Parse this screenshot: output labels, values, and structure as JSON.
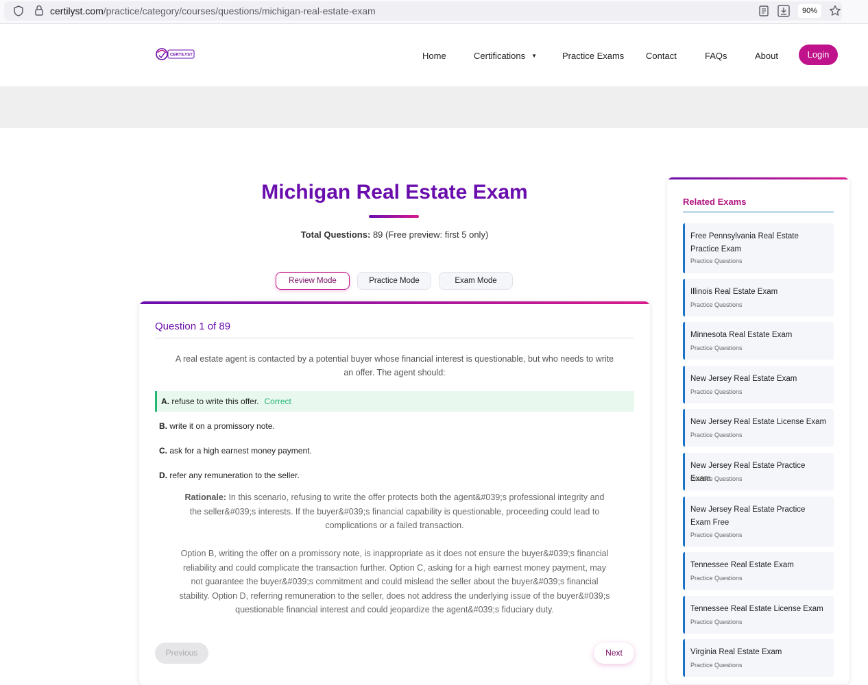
{
  "browser": {
    "url_domain": "certilyst.com",
    "url_path": "/practice/category/courses/questions/michigan-real-estate-exam",
    "zoom": "90%"
  },
  "header": {
    "logo_text": "CERTILYST",
    "nav": {
      "home": "Home",
      "certifications": "Certifications",
      "certifications_caret": "▼",
      "practice_exams": "Practice Exams",
      "contact": "Contact",
      "faqs": "FAQs",
      "about": "About"
    },
    "login": "Login"
  },
  "main": {
    "title": "Michigan Real Estate Exam",
    "total_label": "Total Questions:",
    "total_value": "89 (Free preview: first 5 only)",
    "modes": {
      "review": "Review Mode",
      "practice": "Practice Mode",
      "exam": "Exam Mode"
    }
  },
  "question": {
    "heading": "Question 1 of 89",
    "text": "A real estate agent is contacted by a potential buyer whose financial interest is questionable, but who needs to write an offer. The agent should:",
    "options": [
      {
        "letter": "A.",
        "text": "refuse to write this offer.",
        "tag": "Correct"
      },
      {
        "letter": "B.",
        "text": "write it on a promissory note."
      },
      {
        "letter": "C.",
        "text": "ask for a high earnest money payment."
      },
      {
        "letter": "D.",
        "text": "refer any remuneration to the seller."
      }
    ],
    "rationale_label": "Rationale:",
    "rationale_text": " In this scenario, refusing to write the offer protects both the agent&#039;s professional integrity and the seller&#039;s interests. If the buyer&#039;s financial capability is questionable, proceeding could lead to complications or a failed transaction.",
    "rationale_text2": "Option B, writing the offer on a promissory note, is inappropriate as it does not ensure the buyer&#039;s financial reliability and could complicate the transaction further. Option C, asking for a high earnest money payment, may not guarantee the buyer&#039;s commitment and could mislead the seller about the buyer&#039;s financial stability. Option D, referring remuneration to the seller, does not address the underlying issue of the buyer&#039;s questionable financial interest and could jeopardize the agent&#039;s fiduciary duty.",
    "prev": "Previous",
    "next": "Next"
  },
  "sidebar": {
    "title": "Related Exams",
    "items": [
      {
        "title": "Free Pennsylvania Real Estate Practice Exam",
        "sub": "Practice Questions"
      },
      {
        "title": "Illinois Real Estate Exam",
        "sub": "Practice Questions"
      },
      {
        "title": "Minnesota Real Estate Exam",
        "sub": "Practice Questions"
      },
      {
        "title": "New Jersey Real Estate Exam",
        "sub": "Practice Questions"
      },
      {
        "title": "New Jersey Real Estate License Exam",
        "sub": "Practice Questions"
      },
      {
        "title": "New Jersey Real Estate Practice Exam",
        "sub": "Practice Questions"
      },
      {
        "title": "New Jersey Real Estate Practice Exam Free",
        "sub": "Practice Questions"
      },
      {
        "title": "Tennessee Real Estate Exam",
        "sub": "Practice Questions"
      },
      {
        "title": "Tennessee Real Estate License Exam",
        "sub": "Practice Questions"
      },
      {
        "title": "Virginia Real Estate Exam",
        "sub": "Practice Questions"
      }
    ]
  },
  "colors": {
    "brand_purple": "#6a0dad",
    "brand_magenta": "#c0138b",
    "correct_green": "#22b573",
    "sidebar_accent": "#1a73c8"
  }
}
